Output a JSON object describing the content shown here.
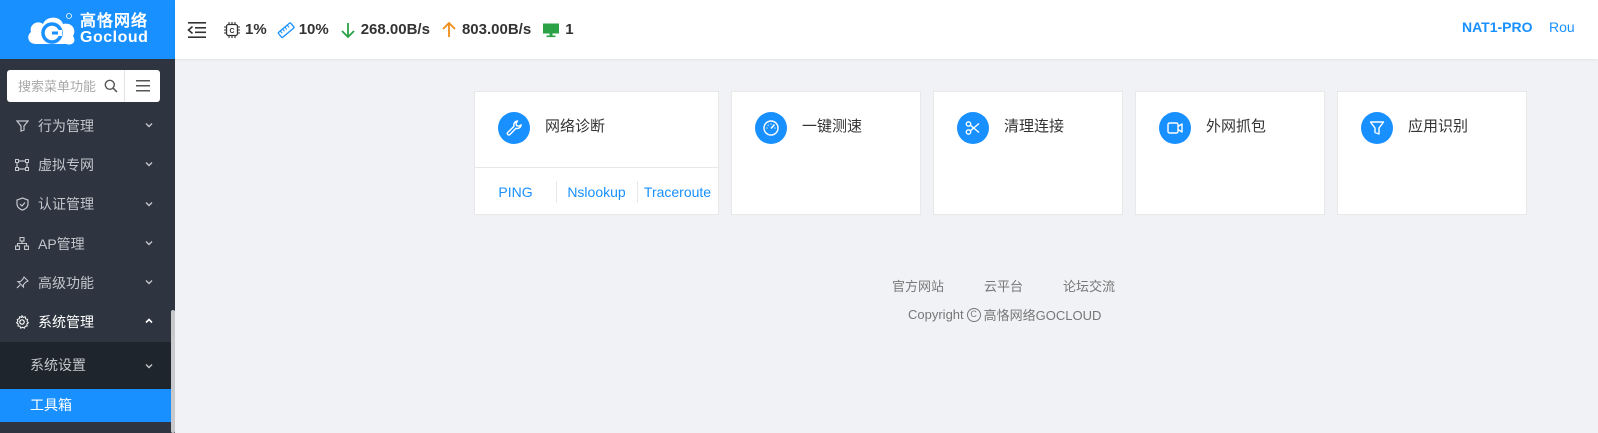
{
  "brand": {
    "name_cn": "高恪网络",
    "name_en": "Gocloud"
  },
  "search": {
    "placeholder": "搜索菜单功能"
  },
  "sidebar": {
    "items": [
      {
        "label": "行为管理",
        "icon": "filter-icon"
      },
      {
        "label": "虚拟专网",
        "icon": "vpn-icon"
      },
      {
        "label": "认证管理",
        "icon": "shield-icon"
      },
      {
        "label": "AP管理",
        "icon": "network-icon"
      },
      {
        "label": "高级功能",
        "icon": "pin-icon"
      },
      {
        "label": "系统管理",
        "icon": "gear-icon"
      }
    ],
    "sub": {
      "label": "系统设置"
    },
    "selected": {
      "label": "工具箱"
    }
  },
  "topbar": {
    "cpu": "1%",
    "memory": "10%",
    "download": "268.00B/s",
    "upload": "803.00B/s",
    "online": "1",
    "device_model": "NAT1-PRO",
    "right_link": "Rou"
  },
  "cards": [
    {
      "title": "网络诊断",
      "icon": "wrench-icon",
      "links": [
        "PING",
        "Nslookup",
        "Traceroute"
      ]
    },
    {
      "title": "一键测速",
      "icon": "speedometer-icon"
    },
    {
      "title": "清理连接",
      "icon": "scissors-icon"
    },
    {
      "title": "外网抓包",
      "icon": "camera-icon"
    },
    {
      "title": "应用识别",
      "icon": "funnel-icon"
    }
  ],
  "footer": {
    "links": [
      "官方网站",
      "云平台",
      "论坛交流"
    ],
    "copyright_prefix": "Copyright",
    "copyright_symbol": "C",
    "copyright_owner": "高恪网络GOCLOUD"
  },
  "colors": {
    "accent": "#1890ff",
    "sidebar_bg": "#2e3540",
    "page_bg": "#f0f2f5",
    "download": "#2ba245",
    "upload": "#f08c1a",
    "online": "#2ba245"
  }
}
